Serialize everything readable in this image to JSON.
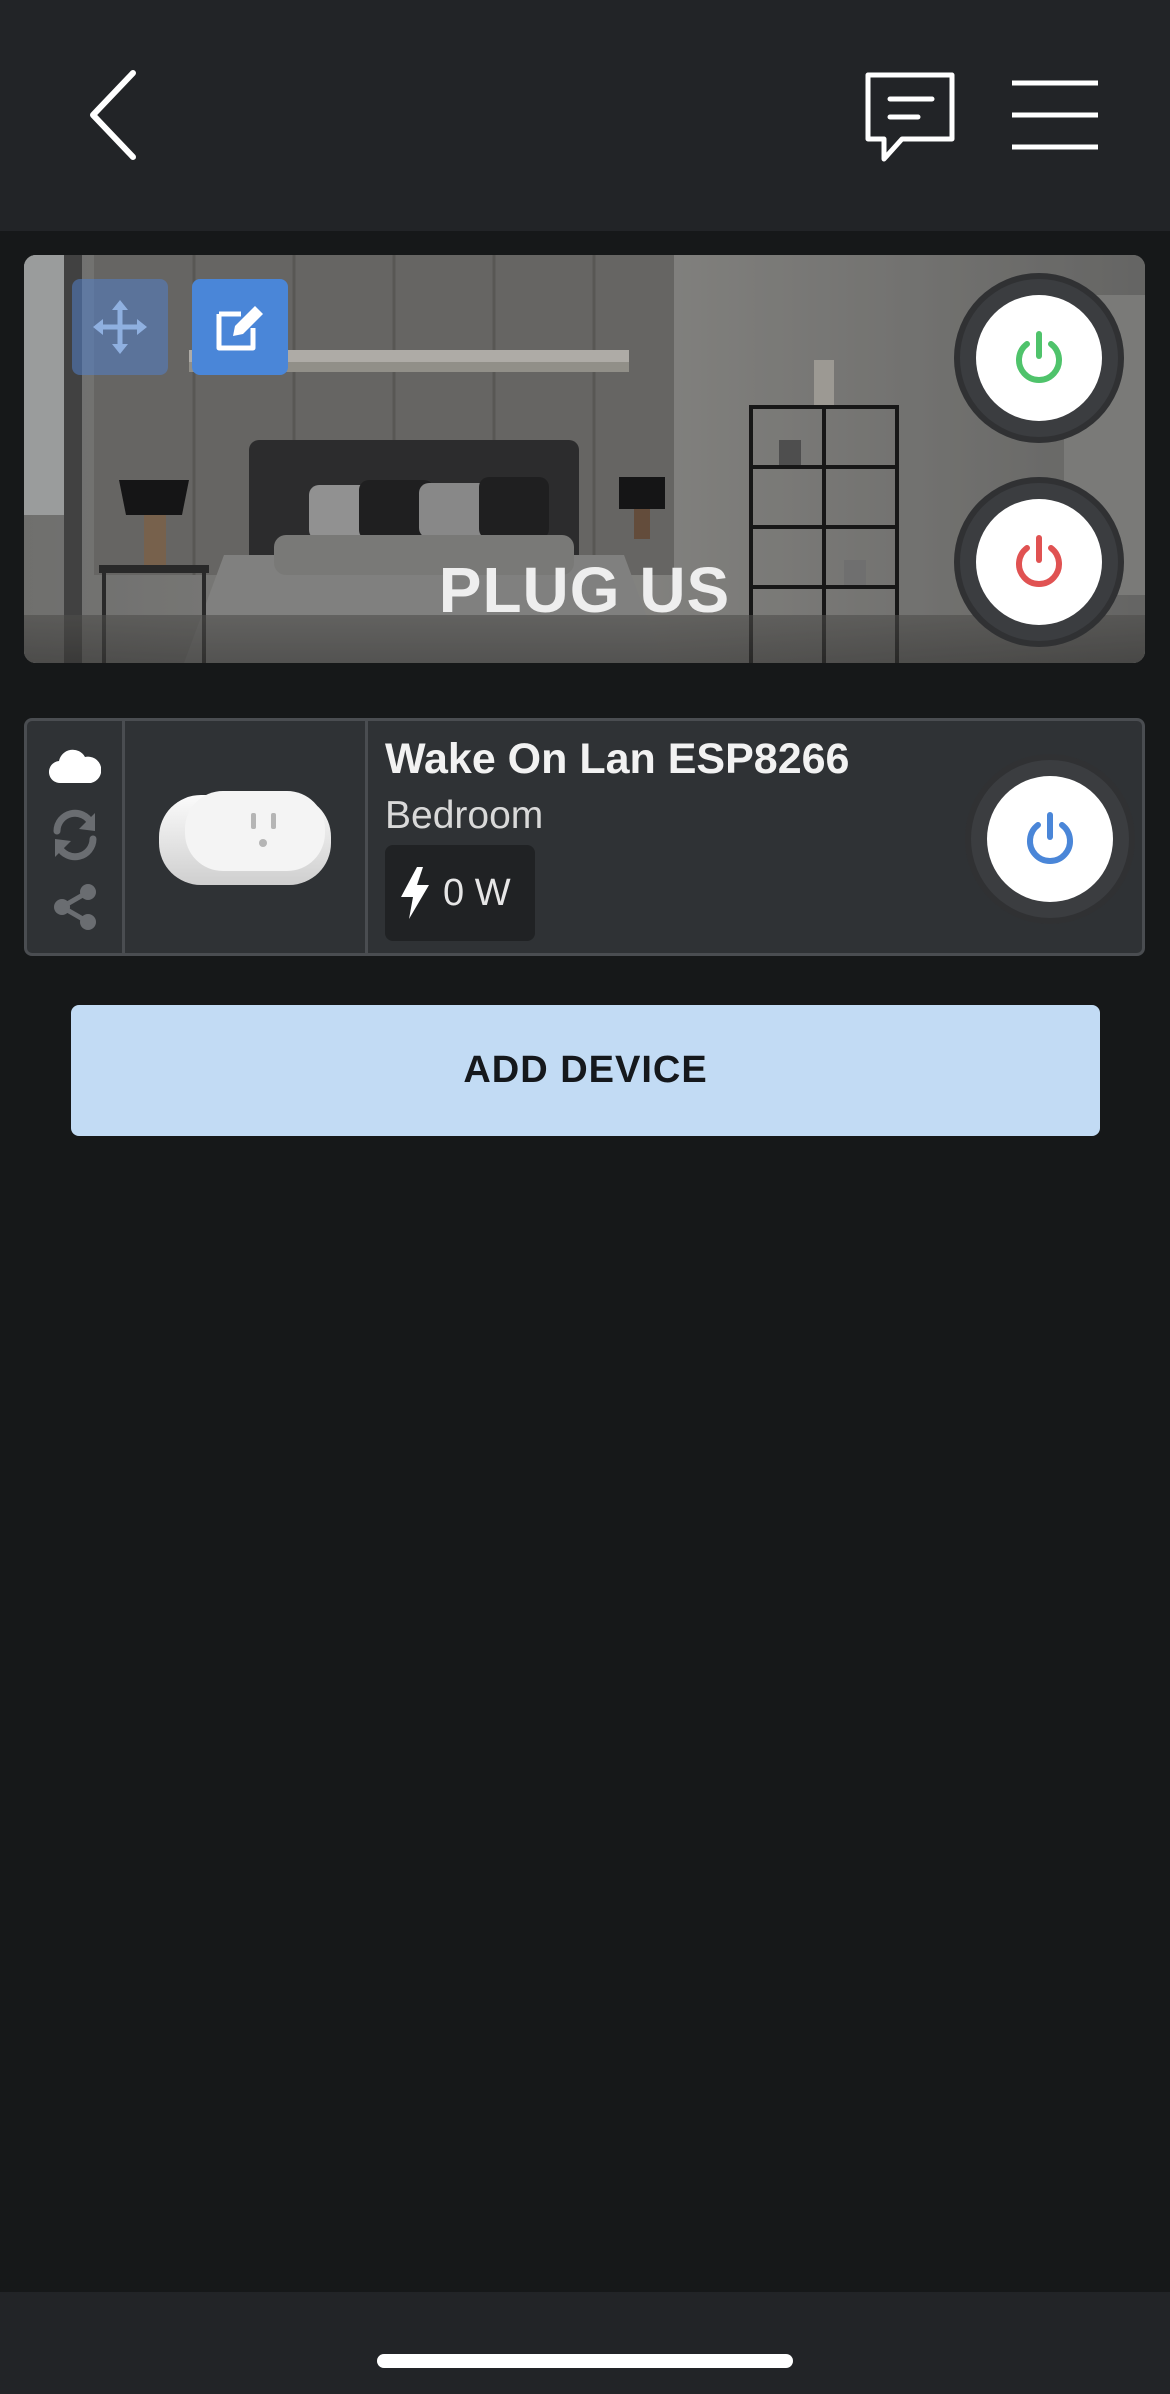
{
  "header": {
    "back_icon": "chevron-left-icon",
    "chat_icon": "chat-bubble-icon",
    "menu_icon": "hamburger-menu-icon"
  },
  "group": {
    "title": "PLUG US",
    "move_icon": "move-arrows-icon",
    "edit_icon": "edit-pencil-icon",
    "all_on_icon": "power-icon",
    "all_off_icon": "power-icon",
    "colors": {
      "on": "#4fc36b",
      "off": "#e05252",
      "edit_bg": "#4a86d8"
    }
  },
  "device": {
    "name": "Wake On Lan ESP8266",
    "room": "Bedroom",
    "power_value": "0 W",
    "cloud_icon": "cloud-icon",
    "refresh_icon": "refresh-icon",
    "share_icon": "share-icon",
    "power_icon": "lightning-bolt-icon",
    "toggle_icon": "power-icon",
    "toggle_color": "#4a86d8"
  },
  "actions": {
    "add_device_label": "ADD DEVICE"
  }
}
